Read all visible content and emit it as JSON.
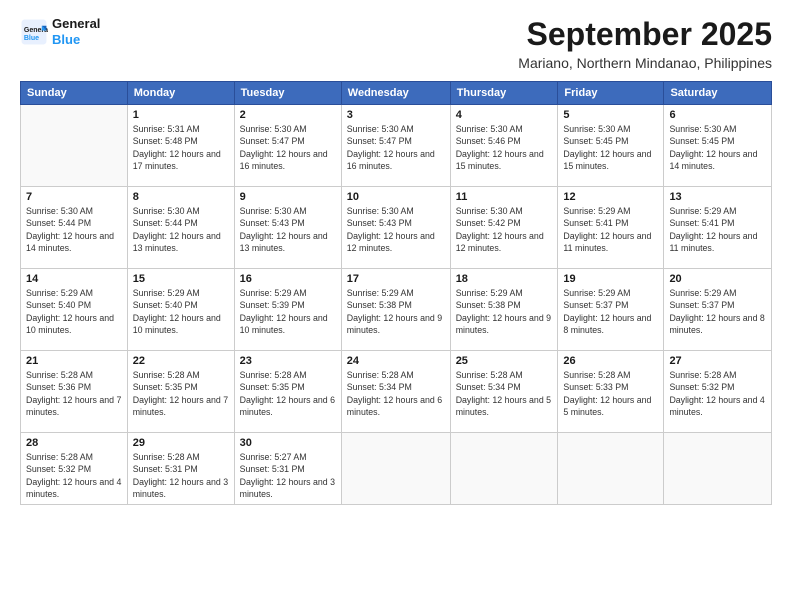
{
  "logo": {
    "line1": "General",
    "line2": "Blue"
  },
  "title": "September 2025",
  "location": "Mariano, Northern Mindanao, Philippines",
  "headers": [
    "Sunday",
    "Monday",
    "Tuesday",
    "Wednesday",
    "Thursday",
    "Friday",
    "Saturday"
  ],
  "weeks": [
    [
      {
        "day": "",
        "sunrise": "",
        "sunset": "",
        "daylight": ""
      },
      {
        "day": "1",
        "sunrise": "Sunrise: 5:31 AM",
        "sunset": "Sunset: 5:48 PM",
        "daylight": "Daylight: 12 hours and 17 minutes."
      },
      {
        "day": "2",
        "sunrise": "Sunrise: 5:30 AM",
        "sunset": "Sunset: 5:47 PM",
        "daylight": "Daylight: 12 hours and 16 minutes."
      },
      {
        "day": "3",
        "sunrise": "Sunrise: 5:30 AM",
        "sunset": "Sunset: 5:47 PM",
        "daylight": "Daylight: 12 hours and 16 minutes."
      },
      {
        "day": "4",
        "sunrise": "Sunrise: 5:30 AM",
        "sunset": "Sunset: 5:46 PM",
        "daylight": "Daylight: 12 hours and 15 minutes."
      },
      {
        "day": "5",
        "sunrise": "Sunrise: 5:30 AM",
        "sunset": "Sunset: 5:45 PM",
        "daylight": "Daylight: 12 hours and 15 minutes."
      },
      {
        "day": "6",
        "sunrise": "Sunrise: 5:30 AM",
        "sunset": "Sunset: 5:45 PM",
        "daylight": "Daylight: 12 hours and 14 minutes."
      }
    ],
    [
      {
        "day": "7",
        "sunrise": "Sunrise: 5:30 AM",
        "sunset": "Sunset: 5:44 PM",
        "daylight": "Daylight: 12 hours and 14 minutes."
      },
      {
        "day": "8",
        "sunrise": "Sunrise: 5:30 AM",
        "sunset": "Sunset: 5:44 PM",
        "daylight": "Daylight: 12 hours and 13 minutes."
      },
      {
        "day": "9",
        "sunrise": "Sunrise: 5:30 AM",
        "sunset": "Sunset: 5:43 PM",
        "daylight": "Daylight: 12 hours and 13 minutes."
      },
      {
        "day": "10",
        "sunrise": "Sunrise: 5:30 AM",
        "sunset": "Sunset: 5:43 PM",
        "daylight": "Daylight: 12 hours and 12 minutes."
      },
      {
        "day": "11",
        "sunrise": "Sunrise: 5:30 AM",
        "sunset": "Sunset: 5:42 PM",
        "daylight": "Daylight: 12 hours and 12 minutes."
      },
      {
        "day": "12",
        "sunrise": "Sunrise: 5:29 AM",
        "sunset": "Sunset: 5:41 PM",
        "daylight": "Daylight: 12 hours and 11 minutes."
      },
      {
        "day": "13",
        "sunrise": "Sunrise: 5:29 AM",
        "sunset": "Sunset: 5:41 PM",
        "daylight": "Daylight: 12 hours and 11 minutes."
      }
    ],
    [
      {
        "day": "14",
        "sunrise": "Sunrise: 5:29 AM",
        "sunset": "Sunset: 5:40 PM",
        "daylight": "Daylight: 12 hours and 10 minutes."
      },
      {
        "day": "15",
        "sunrise": "Sunrise: 5:29 AM",
        "sunset": "Sunset: 5:40 PM",
        "daylight": "Daylight: 12 hours and 10 minutes."
      },
      {
        "day": "16",
        "sunrise": "Sunrise: 5:29 AM",
        "sunset": "Sunset: 5:39 PM",
        "daylight": "Daylight: 12 hours and 10 minutes."
      },
      {
        "day": "17",
        "sunrise": "Sunrise: 5:29 AM",
        "sunset": "Sunset: 5:38 PM",
        "daylight": "Daylight: 12 hours and 9 minutes."
      },
      {
        "day": "18",
        "sunrise": "Sunrise: 5:29 AM",
        "sunset": "Sunset: 5:38 PM",
        "daylight": "Daylight: 12 hours and 9 minutes."
      },
      {
        "day": "19",
        "sunrise": "Sunrise: 5:29 AM",
        "sunset": "Sunset: 5:37 PM",
        "daylight": "Daylight: 12 hours and 8 minutes."
      },
      {
        "day": "20",
        "sunrise": "Sunrise: 5:29 AM",
        "sunset": "Sunset: 5:37 PM",
        "daylight": "Daylight: 12 hours and 8 minutes."
      }
    ],
    [
      {
        "day": "21",
        "sunrise": "Sunrise: 5:28 AM",
        "sunset": "Sunset: 5:36 PM",
        "daylight": "Daylight: 12 hours and 7 minutes."
      },
      {
        "day": "22",
        "sunrise": "Sunrise: 5:28 AM",
        "sunset": "Sunset: 5:35 PM",
        "daylight": "Daylight: 12 hours and 7 minutes."
      },
      {
        "day": "23",
        "sunrise": "Sunrise: 5:28 AM",
        "sunset": "Sunset: 5:35 PM",
        "daylight": "Daylight: 12 hours and 6 minutes."
      },
      {
        "day": "24",
        "sunrise": "Sunrise: 5:28 AM",
        "sunset": "Sunset: 5:34 PM",
        "daylight": "Daylight: 12 hours and 6 minutes."
      },
      {
        "day": "25",
        "sunrise": "Sunrise: 5:28 AM",
        "sunset": "Sunset: 5:34 PM",
        "daylight": "Daylight: 12 hours and 5 minutes."
      },
      {
        "day": "26",
        "sunrise": "Sunrise: 5:28 AM",
        "sunset": "Sunset: 5:33 PM",
        "daylight": "Daylight: 12 hours and 5 minutes."
      },
      {
        "day": "27",
        "sunrise": "Sunrise: 5:28 AM",
        "sunset": "Sunset: 5:32 PM",
        "daylight": "Daylight: 12 hours and 4 minutes."
      }
    ],
    [
      {
        "day": "28",
        "sunrise": "Sunrise: 5:28 AM",
        "sunset": "Sunset: 5:32 PM",
        "daylight": "Daylight: 12 hours and 4 minutes."
      },
      {
        "day": "29",
        "sunrise": "Sunrise: 5:28 AM",
        "sunset": "Sunset: 5:31 PM",
        "daylight": "Daylight: 12 hours and 3 minutes."
      },
      {
        "day": "30",
        "sunrise": "Sunrise: 5:27 AM",
        "sunset": "Sunset: 5:31 PM",
        "daylight": "Daylight: 12 hours and 3 minutes."
      },
      {
        "day": "",
        "sunrise": "",
        "sunset": "",
        "daylight": ""
      },
      {
        "day": "",
        "sunrise": "",
        "sunset": "",
        "daylight": ""
      },
      {
        "day": "",
        "sunrise": "",
        "sunset": "",
        "daylight": ""
      },
      {
        "day": "",
        "sunrise": "",
        "sunset": "",
        "daylight": ""
      }
    ]
  ]
}
